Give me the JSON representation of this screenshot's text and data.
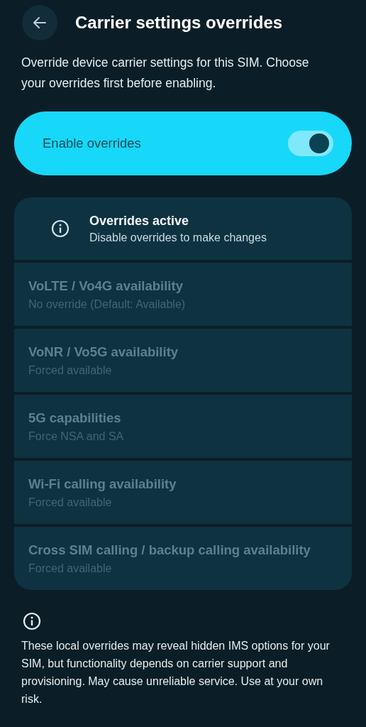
{
  "header": {
    "title": "Carrier settings overrides"
  },
  "description": "Override device carrier settings for this SIM. Choose your overrides first before enabling.",
  "master_switch": {
    "label": "Enable overrides",
    "on": true
  },
  "notice": {
    "title": "Overrides active",
    "subtitle": "Disable overrides to make changes"
  },
  "settings": [
    {
      "title": "VoLTE / Vo4G availability",
      "value": "No override (Default: Available)",
      "disabled": true
    },
    {
      "title": "VoNR / Vo5G availability",
      "value": "Forced available",
      "disabled": true
    },
    {
      "title": "5G capabilities",
      "value": "Force NSA and SA",
      "disabled": true
    },
    {
      "title": "Wi-Fi calling availability",
      "value": "Forced available",
      "disabled": true
    },
    {
      "title": "Cross SIM calling / backup calling availability",
      "value": "Forced available",
      "disabled": true
    }
  ],
  "footer": {
    "text": "These local overrides may reveal hidden IMS options for your SIM, but functionality depends on carrier support and provisioning. May cause unreliable service. Use at your own risk."
  }
}
